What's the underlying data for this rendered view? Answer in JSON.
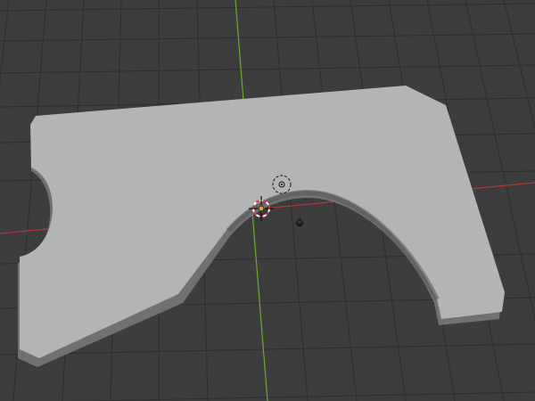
{
  "viewport": {
    "background_color": "#3d3d3d",
    "grid_color": "#2e2e2e",
    "axis_x_color": "#b4363f",
    "axis_y_color": "#6ea82d"
  },
  "mesh": {
    "top_face_color": "#b2b4b5",
    "side_face_color": "#6f7172",
    "side_shadow_color": "#565859"
  },
  "gizmos": {
    "origin_color": "#f0a020",
    "cursor_ring_color_a": "#ffffff",
    "cursor_ring_color_b": "#e0303a",
    "icons": [
      "3d-cursor-icon",
      "object-origin-icon",
      "light-icon",
      "camera-icon"
    ]
  }
}
